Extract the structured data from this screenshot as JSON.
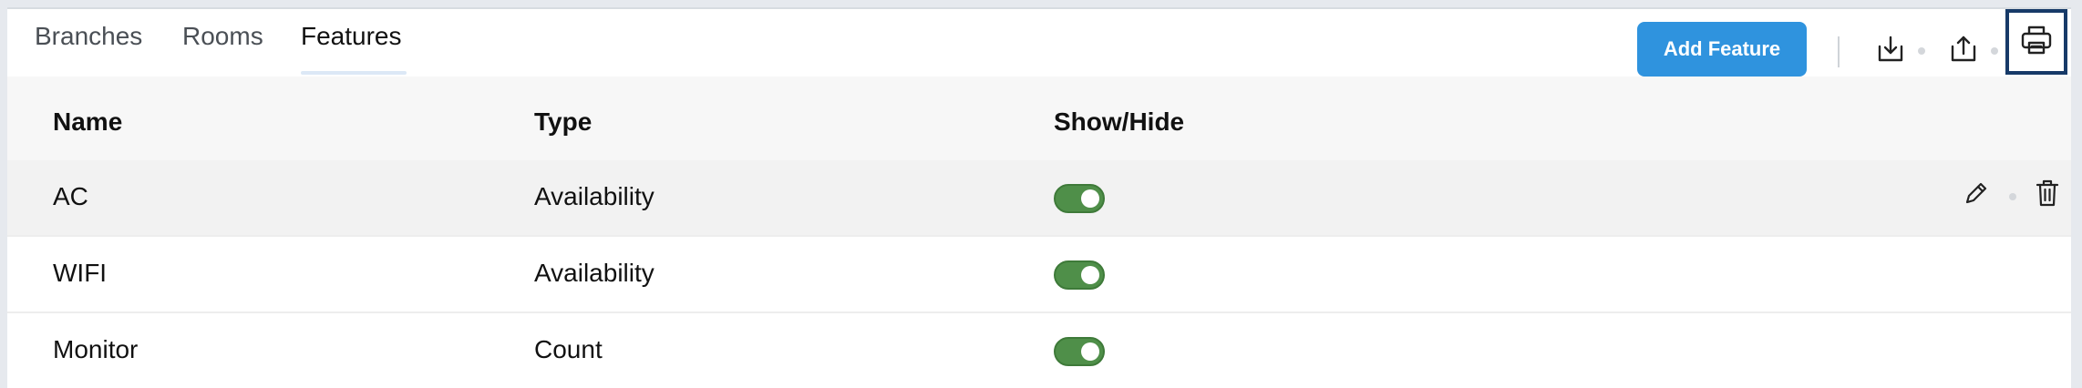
{
  "tabs": [
    {
      "label": "Branches",
      "active": false
    },
    {
      "label": "Rooms",
      "active": false
    },
    {
      "label": "Features",
      "active": true
    }
  ],
  "toolbar": {
    "add_label": "Add Feature",
    "icons": [
      "download-icon",
      "upload-icon",
      "print-icon"
    ]
  },
  "table": {
    "headers": [
      "Name",
      "Type",
      "Show/Hide"
    ],
    "rows": [
      {
        "name": "AC",
        "type": "Availability",
        "visible": true
      },
      {
        "name": "WIFI",
        "type": "Availability",
        "visible": true
      },
      {
        "name": "Monitor",
        "type": "Count",
        "visible": true
      }
    ],
    "row_actions": [
      "edit-icon",
      "delete-icon"
    ]
  },
  "colors": {
    "accent": "#2f93de",
    "toggle_on": "#4f8f49",
    "focus_outline": "#173a68"
  }
}
